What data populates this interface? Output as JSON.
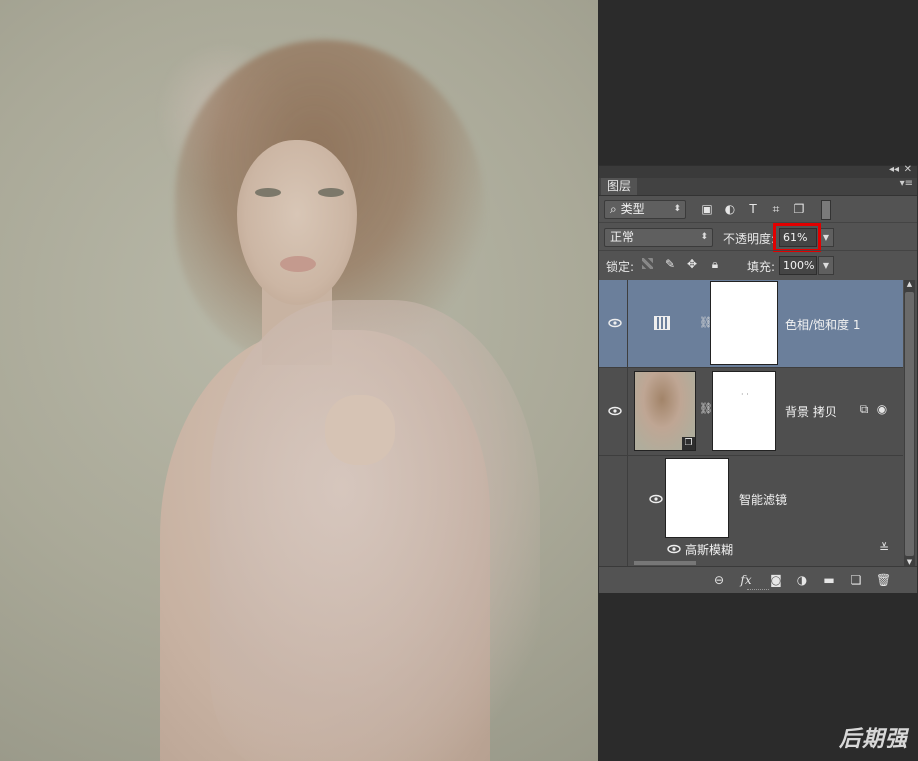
{
  "panel": {
    "tab_label": "图层",
    "tab_menu_icon": "panel-menu-icon",
    "collapse_icon": "double-chevron-left-icon",
    "close_icon": "close-icon",
    "filter": {
      "kind_label": "类型",
      "icons": [
        "image-filter-icon",
        "adjustment-filter-icon",
        "text-filter-icon",
        "shape-filter-icon",
        "smart-object-filter-icon"
      ]
    },
    "blend_mode": "正常",
    "opacity_label": "不透明度:",
    "opacity_value": "61%",
    "lock_label": "锁定:",
    "fill_label": "填充:",
    "fill_value": "100%",
    "layers": [
      {
        "name": "色相/饱和度 1",
        "type": "adjustment",
        "selected": true,
        "visible": true
      },
      {
        "name": "背景 拷贝",
        "type": "smart-object",
        "selected": false,
        "visible": true
      },
      {
        "name": "智能滤镜",
        "type": "smart-filter-mask",
        "visible": true
      },
      {
        "name": "高斯模糊",
        "type": "filter",
        "visible": true
      }
    ],
    "bottom_icons": [
      "link-icon",
      "fx-icon",
      "mask-icon",
      "adjustment-icon",
      "folder-icon",
      "new-layer-icon",
      "trash-icon"
    ],
    "fx_label": "fx"
  },
  "highlight_color": "#e20000",
  "selection_color": "#6b7f9b",
  "watermark": "后期强"
}
